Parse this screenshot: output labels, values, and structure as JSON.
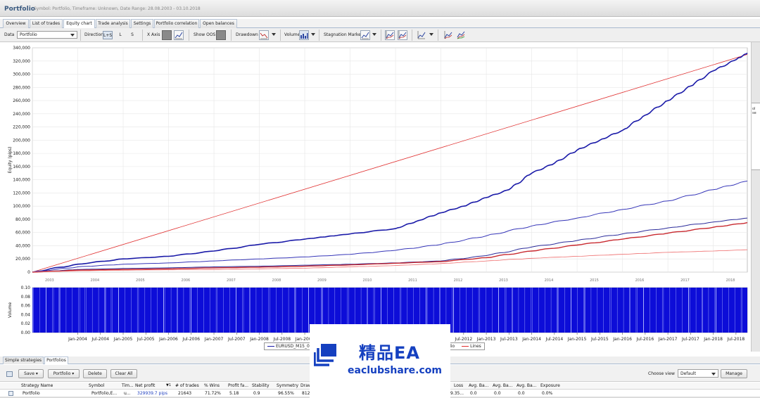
{
  "window": {
    "title": "Portfolio",
    "subtitle": "Symbol: Portfolio, Timeframe: Unknown, Date Range: 28.08.2003 - 03.10.2018"
  },
  "tabs": [
    {
      "label": "Overview"
    },
    {
      "label": "List of trades"
    },
    {
      "label": "Equity chart",
      "active": true
    },
    {
      "label": "Trade analysis"
    },
    {
      "label": "Settings"
    },
    {
      "label": "Portfolio correlation"
    },
    {
      "label": "Open balances"
    }
  ],
  "toolbar": {
    "data_label": "Data",
    "data_value": "Portfolio",
    "direction_label": "Direction",
    "direction_options": [
      "L+S",
      "L",
      "S"
    ],
    "xaxis_label": "X Axis",
    "show_oos_label": "Show OOS",
    "drawdown_label": "Drawdown",
    "volume_label": "Volume",
    "stagnation_label": "Stagnation Marker"
  },
  "right_panel": {
    "label": "ol se"
  },
  "chart_data": [
    {
      "type": "line",
      "ylabel": "Equity (pips)",
      "ylim": [
        0,
        340000
      ],
      "yticks": [
        0,
        20000,
        40000,
        60000,
        80000,
        100000,
        120000,
        140000,
        160000,
        180000,
        200000,
        220000,
        240000,
        260000,
        280000,
        300000,
        320000,
        340000
      ],
      "ytick_labels": [
        "0",
        "20,000",
        "40,000",
        "60,000",
        "80,000",
        "100,000",
        "120,000",
        "140,000",
        "160,000",
        "180,000",
        "200,000",
        "220,000",
        "240,000",
        "260,000",
        "280,000",
        "300,000",
        "320,000",
        "340,000"
      ],
      "xlim": [
        2003.0,
        2018.75
      ],
      "year_labels": [
        "2003",
        "2004",
        "2005",
        "2006",
        "2007",
        "2008",
        "2009",
        "2010",
        "2011",
        "2012",
        "2013",
        "2014",
        "2015",
        "2016",
        "2017",
        "2018"
      ],
      "grid": true,
      "series": [
        {
          "name": "Lines",
          "color": "#e03030",
          "width": 0.8,
          "x": [
            2003.0,
            2018.75
          ],
          "y": [
            0,
            330000
          ]
        },
        {
          "name": "EURUSD_M15_01",
          "color": "#1a1aa8",
          "width": 1.6,
          "x": [
            2003.0,
            2004.0,
            2005.0,
            2006.0,
            2007.0,
            2008.0,
            2009.0,
            2009.5,
            2010.0,
            2011.0,
            2011.5,
            2012.0,
            2012.5,
            2013.0,
            2013.5,
            2014.0,
            2014.5,
            2015.0,
            2015.5,
            2016.0,
            2016.5,
            2017.0,
            2017.5,
            2018.0,
            2018.5,
            2018.75
          ],
          "y": [
            0,
            12000,
            20000,
            24000,
            32000,
            42000,
            50000,
            54000,
            58000,
            66000,
            78000,
            90000,
            100000,
            113000,
            125000,
            150000,
            165000,
            185000,
            200000,
            215000,
            238000,
            260000,
            282000,
            305000,
            322000,
            332000
          ]
        },
        {
          "name": "",
          "color": "#3535b8",
          "width": 1.0,
          "x": [
            2003.0,
            2004.0,
            2005.0,
            2006.0,
            2007.0,
            2008.0,
            2009.0,
            2010.0,
            2011.0,
            2012.0,
            2013.0,
            2014.0,
            2015.0,
            2016.0,
            2017.0,
            2018.0,
            2018.75
          ],
          "y": [
            0,
            8000,
            12000,
            14000,
            17000,
            20000,
            23000,
            27000,
            33000,
            42000,
            55000,
            70000,
            82000,
            95000,
            108000,
            125000,
            138000
          ]
        },
        {
          "name": "",
          "color": "#2a2a9a",
          "width": 1.0,
          "x": [
            2003.0,
            2004.0,
            2005.0,
            2006.0,
            2007.0,
            2008.0,
            2009.0,
            2010.0,
            2011.0,
            2012.0,
            2013.0,
            2014.0,
            2015.0,
            2016.0,
            2017.0,
            2018.0,
            2018.75
          ],
          "y": [
            0,
            4000,
            5500,
            6500,
            8000,
            9000,
            10500,
            12000,
            14000,
            17000,
            25000,
            38000,
            48000,
            58000,
            67000,
            76000,
            82000
          ]
        },
        {
          "name": "",
          "color": "#c8282e",
          "width": 1.4,
          "x": [
            2003.0,
            2004.0,
            2005.0,
            2006.0,
            2007.0,
            2008.0,
            2009.0,
            2010.0,
            2011.0,
            2012.0,
            2013.0,
            2014.0,
            2015.0,
            2016.0,
            2017.0,
            2018.0,
            2018.75
          ],
          "y": [
            0,
            3000,
            4000,
            5000,
            6500,
            7500,
            9000,
            11000,
            13500,
            16000,
            22000,
            32000,
            41000,
            50000,
            59000,
            68000,
            75000
          ]
        },
        {
          "name": "",
          "color": "#ee6a6a",
          "width": 0.8,
          "x": [
            2003.0,
            2004.0,
            2005.0,
            2006.0,
            2007.0,
            2008.0,
            2009.0,
            2010.0,
            2011.0,
            2012.0,
            2013.0,
            2014.0,
            2015.0,
            2016.0,
            2017.0,
            2018.0,
            2018.75
          ],
          "y": [
            0,
            2000,
            3000,
            3500,
            4000,
            5000,
            6000,
            8000,
            10000,
            13000,
            17000,
            21000,
            24000,
            27000,
            30000,
            32000,
            34000
          ]
        }
      ]
    },
    {
      "type": "bar",
      "ylabel": "Volume",
      "ylim": [
        0,
        0.1
      ],
      "yticks": [
        0,
        0.02,
        0.04,
        0.06,
        0.08,
        0.1
      ],
      "ytick_labels": [
        "0.00",
        "0.02",
        "0.04",
        "0.06",
        "0.08",
        "0.10"
      ],
      "value": 0.1,
      "color": "#0d0dd8",
      "xlim": [
        2003.0,
        2018.75
      ],
      "x_tick_labels": [
        "Jan-2004",
        "Jul-2004",
        "Jan-2005",
        "Jul-2005",
        "Jan-2006",
        "Jul-2006",
        "Jan-2007",
        "Jul-2007",
        "Jan-2008",
        "Jul-2008",
        "Jan-2009",
        "Jul-2009",
        "Jan-2010",
        "Jul-2010",
        "Jan-2011",
        "Jul-2011",
        "Jan-2012",
        "Jul-2012",
        "Jan-2013",
        "Jul-2013",
        "Jan-2014",
        "Jul-2014",
        "Jan-2015",
        "Jul-2015",
        "Jan-2016",
        "Jul-2016",
        "Jan-2017",
        "Jul-2017",
        "Jan-2018",
        "Jul-2018"
      ],
      "x_ticks": [
        2004.0,
        2004.5,
        2005.0,
        2005.5,
        2006.0,
        2006.5,
        2007.0,
        2007.5,
        2008.0,
        2008.5,
        2009.0,
        2009.5,
        2010.0,
        2010.5,
        2011.0,
        2011.5,
        2012.0,
        2012.5,
        2013.0,
        2013.5,
        2014.0,
        2014.5,
        2015.0,
        2015.5,
        2016.0,
        2016.5,
        2017.0,
        2017.5,
        2018.0,
        2018.5
      ]
    }
  ],
  "legend": {
    "items": [
      {
        "label": "EURUSD_M15_01",
        "color": "#1a1aa8"
      },
      {
        "label": "Portfolio",
        "color": "#1a1aa8"
      },
      {
        "label": "Lines",
        "color": "#e03030"
      }
    ]
  },
  "bottom_tabs": [
    {
      "label": "Simple strategies"
    },
    {
      "label": "Portfolios",
      "active": true
    }
  ],
  "strategies_toolbar": {
    "save_label": "Save",
    "portfolio_label": "Portfolio",
    "delete_label": "Delete",
    "clear_all_label": "Clear All",
    "choose_view_label": "Choose view",
    "view_value": "Default",
    "manage_label": "Manage"
  },
  "table": {
    "headers": [
      "Strategy Name",
      "Symbol",
      "Tim...",
      "Net profit",
      "# of trades",
      "% Wins",
      "Profit fa...",
      "Stability",
      "Symmetry",
      "Draw",
      "Loss",
      "Avg. Ba...",
      "Avg. Ba...",
      "Avg. Ba...",
      "Exposure"
    ],
    "rows": [
      [
        "Portfolio",
        "Portfolio,E...",
        "u...",
        "329939.7 pips",
        "21643",
        "71.72%",
        "5.18",
        "0.9",
        "96.55%",
        "812",
        "9.35...",
        "0.0",
        "0.0",
        "0.0",
        "0.0%"
      ]
    ]
  },
  "watermark": {
    "brand": "精品EA",
    "url": "eaclubshare.com"
  }
}
